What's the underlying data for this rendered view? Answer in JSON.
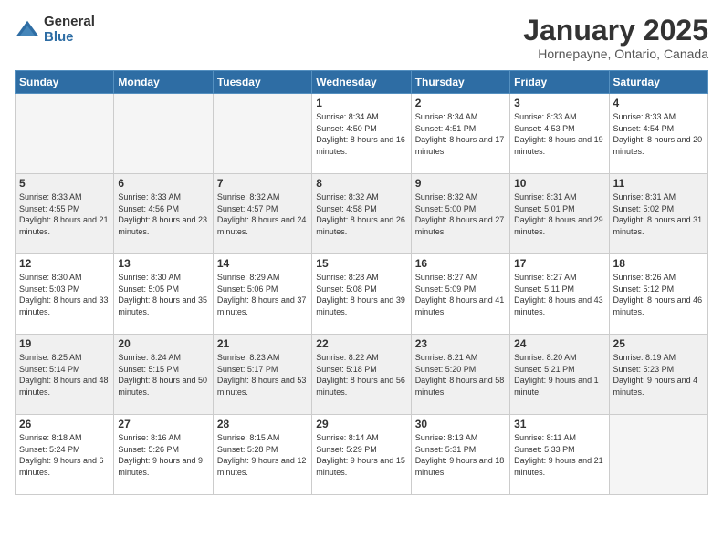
{
  "logo": {
    "general": "General",
    "blue": "Blue"
  },
  "header": {
    "title": "January 2025",
    "location": "Hornepayne, Ontario, Canada"
  },
  "weekdays": [
    "Sunday",
    "Monday",
    "Tuesday",
    "Wednesday",
    "Thursday",
    "Friday",
    "Saturday"
  ],
  "weeks": [
    [
      {
        "day": "",
        "info": ""
      },
      {
        "day": "",
        "info": ""
      },
      {
        "day": "",
        "info": ""
      },
      {
        "day": "1",
        "info": "Sunrise: 8:34 AM\nSunset: 4:50 PM\nDaylight: 8 hours and 16 minutes."
      },
      {
        "day": "2",
        "info": "Sunrise: 8:34 AM\nSunset: 4:51 PM\nDaylight: 8 hours and 17 minutes."
      },
      {
        "day": "3",
        "info": "Sunrise: 8:33 AM\nSunset: 4:53 PM\nDaylight: 8 hours and 19 minutes."
      },
      {
        "day": "4",
        "info": "Sunrise: 8:33 AM\nSunset: 4:54 PM\nDaylight: 8 hours and 20 minutes."
      }
    ],
    [
      {
        "day": "5",
        "info": "Sunrise: 8:33 AM\nSunset: 4:55 PM\nDaylight: 8 hours and 21 minutes."
      },
      {
        "day": "6",
        "info": "Sunrise: 8:33 AM\nSunset: 4:56 PM\nDaylight: 8 hours and 23 minutes."
      },
      {
        "day": "7",
        "info": "Sunrise: 8:32 AM\nSunset: 4:57 PM\nDaylight: 8 hours and 24 minutes."
      },
      {
        "day": "8",
        "info": "Sunrise: 8:32 AM\nSunset: 4:58 PM\nDaylight: 8 hours and 26 minutes."
      },
      {
        "day": "9",
        "info": "Sunrise: 8:32 AM\nSunset: 5:00 PM\nDaylight: 8 hours and 27 minutes."
      },
      {
        "day": "10",
        "info": "Sunrise: 8:31 AM\nSunset: 5:01 PM\nDaylight: 8 hours and 29 minutes."
      },
      {
        "day": "11",
        "info": "Sunrise: 8:31 AM\nSunset: 5:02 PM\nDaylight: 8 hours and 31 minutes."
      }
    ],
    [
      {
        "day": "12",
        "info": "Sunrise: 8:30 AM\nSunset: 5:03 PM\nDaylight: 8 hours and 33 minutes."
      },
      {
        "day": "13",
        "info": "Sunrise: 8:30 AM\nSunset: 5:05 PM\nDaylight: 8 hours and 35 minutes."
      },
      {
        "day": "14",
        "info": "Sunrise: 8:29 AM\nSunset: 5:06 PM\nDaylight: 8 hours and 37 minutes."
      },
      {
        "day": "15",
        "info": "Sunrise: 8:28 AM\nSunset: 5:08 PM\nDaylight: 8 hours and 39 minutes."
      },
      {
        "day": "16",
        "info": "Sunrise: 8:27 AM\nSunset: 5:09 PM\nDaylight: 8 hours and 41 minutes."
      },
      {
        "day": "17",
        "info": "Sunrise: 8:27 AM\nSunset: 5:11 PM\nDaylight: 8 hours and 43 minutes."
      },
      {
        "day": "18",
        "info": "Sunrise: 8:26 AM\nSunset: 5:12 PM\nDaylight: 8 hours and 46 minutes."
      }
    ],
    [
      {
        "day": "19",
        "info": "Sunrise: 8:25 AM\nSunset: 5:14 PM\nDaylight: 8 hours and 48 minutes."
      },
      {
        "day": "20",
        "info": "Sunrise: 8:24 AM\nSunset: 5:15 PM\nDaylight: 8 hours and 50 minutes."
      },
      {
        "day": "21",
        "info": "Sunrise: 8:23 AM\nSunset: 5:17 PM\nDaylight: 8 hours and 53 minutes."
      },
      {
        "day": "22",
        "info": "Sunrise: 8:22 AM\nSunset: 5:18 PM\nDaylight: 8 hours and 56 minutes."
      },
      {
        "day": "23",
        "info": "Sunrise: 8:21 AM\nSunset: 5:20 PM\nDaylight: 8 hours and 58 minutes."
      },
      {
        "day": "24",
        "info": "Sunrise: 8:20 AM\nSunset: 5:21 PM\nDaylight: 9 hours and 1 minute."
      },
      {
        "day": "25",
        "info": "Sunrise: 8:19 AM\nSunset: 5:23 PM\nDaylight: 9 hours and 4 minutes."
      }
    ],
    [
      {
        "day": "26",
        "info": "Sunrise: 8:18 AM\nSunset: 5:24 PM\nDaylight: 9 hours and 6 minutes."
      },
      {
        "day": "27",
        "info": "Sunrise: 8:16 AM\nSunset: 5:26 PM\nDaylight: 9 hours and 9 minutes."
      },
      {
        "day": "28",
        "info": "Sunrise: 8:15 AM\nSunset: 5:28 PM\nDaylight: 9 hours and 12 minutes."
      },
      {
        "day": "29",
        "info": "Sunrise: 8:14 AM\nSunset: 5:29 PM\nDaylight: 9 hours and 15 minutes."
      },
      {
        "day": "30",
        "info": "Sunrise: 8:13 AM\nSunset: 5:31 PM\nDaylight: 9 hours and 18 minutes."
      },
      {
        "day": "31",
        "info": "Sunrise: 8:11 AM\nSunset: 5:33 PM\nDaylight: 9 hours and 21 minutes."
      },
      {
        "day": "",
        "info": ""
      }
    ]
  ],
  "colors": {
    "header_bg": "#2e6da4",
    "shaded_row": "#f0f0f0",
    "white_row": "#ffffff"
  }
}
